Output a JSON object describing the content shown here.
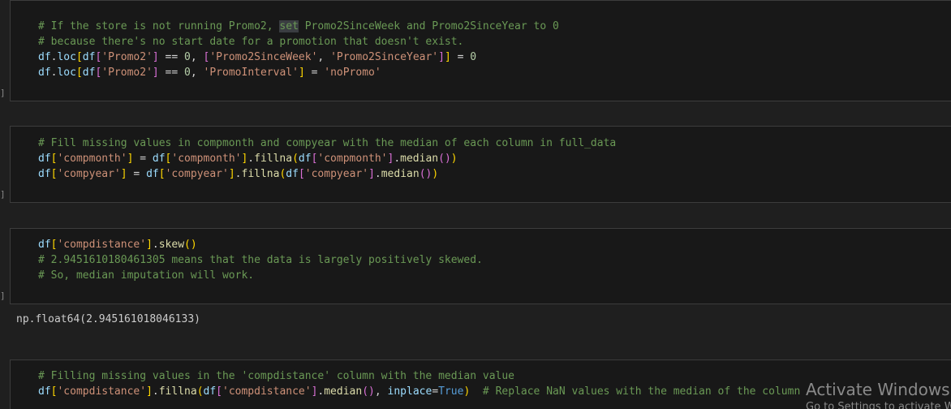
{
  "cells": [
    {
      "lines": [
        [
          {
            "t": "# If the store is not running Promo2, ",
            "c": "cm"
          },
          {
            "t": "set",
            "c": "cm hl"
          },
          {
            "t": " Promo2SinceWeek and Promo2SinceYear to 0",
            "c": "cm"
          }
        ],
        [
          {
            "t": "# because there's no start date for a promotion that doesn't exist.",
            "c": "cm"
          }
        ],
        [
          {
            "t": "df",
            "c": "vr"
          },
          {
            "t": ".",
            "c": "pl"
          },
          {
            "t": "loc",
            "c": "vr"
          },
          {
            "t": "[",
            "c": "b1"
          },
          {
            "t": "df",
            "c": "vr"
          },
          {
            "t": "[",
            "c": "b2"
          },
          {
            "t": "'Promo2'",
            "c": "st"
          },
          {
            "t": "]",
            "c": "b2"
          },
          {
            "t": " == ",
            "c": "op"
          },
          {
            "t": "0",
            "c": "nu"
          },
          {
            "t": ", ",
            "c": "pl"
          },
          {
            "t": "[",
            "c": "b2"
          },
          {
            "t": "'Promo2SinceWeek'",
            "c": "st"
          },
          {
            "t": ", ",
            "c": "pl"
          },
          {
            "t": "'Promo2SinceYear'",
            "c": "st"
          },
          {
            "t": "]",
            "c": "b2"
          },
          {
            "t": "]",
            "c": "b1"
          },
          {
            "t": " = ",
            "c": "op"
          },
          {
            "t": "0",
            "c": "nu"
          }
        ],
        [
          {
            "t": "df",
            "c": "vr"
          },
          {
            "t": ".",
            "c": "pl"
          },
          {
            "t": "loc",
            "c": "vr"
          },
          {
            "t": "[",
            "c": "b1"
          },
          {
            "t": "df",
            "c": "vr"
          },
          {
            "t": "[",
            "c": "b2"
          },
          {
            "t": "'Promo2'",
            "c": "st"
          },
          {
            "t": "]",
            "c": "b2"
          },
          {
            "t": " == ",
            "c": "op"
          },
          {
            "t": "0",
            "c": "nu"
          },
          {
            "t": ", ",
            "c": "pl"
          },
          {
            "t": "'PromoInterval'",
            "c": "st"
          },
          {
            "t": "]",
            "c": "b1"
          },
          {
            "t": " = ",
            "c": "op"
          },
          {
            "t": "'noPromo'",
            "c": "st"
          }
        ]
      ]
    },
    {
      "lines": [
        [
          {
            "t": "# Fill missing values in compmonth and compyear with the median of each column in full_data",
            "c": "cm"
          }
        ],
        [
          {
            "t": "df",
            "c": "vr"
          },
          {
            "t": "[",
            "c": "b1"
          },
          {
            "t": "'compmonth'",
            "c": "st"
          },
          {
            "t": "]",
            "c": "b1"
          },
          {
            "t": " = ",
            "c": "op"
          },
          {
            "t": "df",
            "c": "vr"
          },
          {
            "t": "[",
            "c": "b1"
          },
          {
            "t": "'compmonth'",
            "c": "st"
          },
          {
            "t": "]",
            "c": "b1"
          },
          {
            "t": ".",
            "c": "pl"
          },
          {
            "t": "fillna",
            "c": "fn"
          },
          {
            "t": "(",
            "c": "b1"
          },
          {
            "t": "df",
            "c": "vr"
          },
          {
            "t": "[",
            "c": "b2"
          },
          {
            "t": "'compmonth'",
            "c": "st"
          },
          {
            "t": "]",
            "c": "b2"
          },
          {
            "t": ".",
            "c": "pl"
          },
          {
            "t": "median",
            "c": "fn"
          },
          {
            "t": "()",
            "c": "b2"
          },
          {
            "t": ")",
            "c": "b1"
          }
        ],
        [
          {
            "t": "df",
            "c": "vr"
          },
          {
            "t": "[",
            "c": "b1"
          },
          {
            "t": "'compyear'",
            "c": "st"
          },
          {
            "t": "]",
            "c": "b1"
          },
          {
            "t": " = ",
            "c": "op"
          },
          {
            "t": "df",
            "c": "vr"
          },
          {
            "t": "[",
            "c": "b1"
          },
          {
            "t": "'compyear'",
            "c": "st"
          },
          {
            "t": "]",
            "c": "b1"
          },
          {
            "t": ".",
            "c": "pl"
          },
          {
            "t": "fillna",
            "c": "fn"
          },
          {
            "t": "(",
            "c": "b1"
          },
          {
            "t": "df",
            "c": "vr"
          },
          {
            "t": "[",
            "c": "b2"
          },
          {
            "t": "'compyear'",
            "c": "st"
          },
          {
            "t": "]",
            "c": "b2"
          },
          {
            "t": ".",
            "c": "pl"
          },
          {
            "t": "median",
            "c": "fn"
          },
          {
            "t": "()",
            "c": "b2"
          },
          {
            "t": ")",
            "c": "b1"
          }
        ]
      ]
    },
    {
      "lines": [
        [
          {
            "t": "df",
            "c": "vr"
          },
          {
            "t": "[",
            "c": "b1"
          },
          {
            "t": "'compdistance'",
            "c": "st"
          },
          {
            "t": "]",
            "c": "b1"
          },
          {
            "t": ".",
            "c": "pl"
          },
          {
            "t": "skew",
            "c": "fn"
          },
          {
            "t": "()",
            "c": "b1"
          }
        ],
        [
          {
            "t": "# 2.9451610180461305 means that the data is largely positively skewed.",
            "c": "cm"
          }
        ],
        [
          {
            "t": "# So, median imputation will work.",
            "c": "cm"
          }
        ]
      ],
      "output": "np.float64(2.945161018046133)"
    },
    {
      "lines": [
        [
          {
            "t": "# Filling missing values in the 'compdistance' column with the median value",
            "c": "cm"
          }
        ],
        [
          {
            "t": "df",
            "c": "vr"
          },
          {
            "t": "[",
            "c": "b1"
          },
          {
            "t": "'compdistance'",
            "c": "st"
          },
          {
            "t": "]",
            "c": "b1"
          },
          {
            "t": ".",
            "c": "pl"
          },
          {
            "t": "fillna",
            "c": "fn"
          },
          {
            "t": "(",
            "c": "b1"
          },
          {
            "t": "df",
            "c": "vr"
          },
          {
            "t": "[",
            "c": "b2"
          },
          {
            "t": "'compdistance'",
            "c": "st"
          },
          {
            "t": "]",
            "c": "b2"
          },
          {
            "t": ".",
            "c": "pl"
          },
          {
            "t": "median",
            "c": "fn"
          },
          {
            "t": "()",
            "c": "b2"
          },
          {
            "t": ", ",
            "c": "pl"
          },
          {
            "t": "inplace",
            "c": "vr"
          },
          {
            "t": "=",
            "c": "op"
          },
          {
            "t": "True",
            "c": "kw"
          },
          {
            "t": ")",
            "c": "b1"
          },
          {
            "t": "  # Replace NaN values with the median of the column",
            "c": "cm"
          }
        ]
      ]
    }
  ],
  "cell_markers": [
    "]",
    "]",
    "]"
  ],
  "watermark": {
    "title": "Activate Windows",
    "subtitle": "Go to Settings to activate Windows."
  }
}
